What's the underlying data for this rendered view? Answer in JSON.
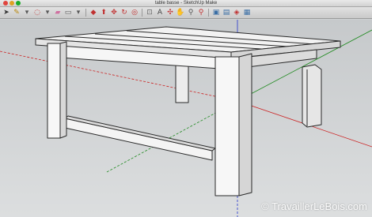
{
  "window": {
    "title": "table basse - SketchUp Make"
  },
  "toolbar": {
    "tools": [
      {
        "name": "select-tool",
        "glyph": "➤",
        "color": "#333333"
      },
      {
        "name": "pencil-tool",
        "glyph": "✎",
        "color": "#b8860b"
      },
      {
        "name": "dropdown-arrow",
        "glyph": "▾",
        "color": "#555555"
      },
      {
        "name": "lasso-tool",
        "glyph": "◌",
        "color": "#c03030"
      },
      {
        "name": "dropdown-arrow",
        "glyph": "▾",
        "color": "#555555"
      },
      {
        "name": "eraser-tool",
        "glyph": "▰",
        "color": "#d070a0"
      },
      {
        "name": "rectangle-tool",
        "glyph": "▭",
        "color": "#555555"
      },
      {
        "name": "dropdown-arrow",
        "glyph": "▾",
        "color": "#555555"
      },
      {
        "name": "paint-bucket-tool",
        "glyph": "◆",
        "color": "#c03030"
      },
      {
        "name": "push-pull-tool",
        "glyph": "⬆",
        "color": "#c03030"
      },
      {
        "name": "move-tool",
        "glyph": "✥",
        "color": "#c03030"
      },
      {
        "name": "rotate-tool",
        "glyph": "↻",
        "color": "#c03030"
      },
      {
        "name": "offset-tool",
        "glyph": "◎",
        "color": "#c03030"
      },
      {
        "name": "tape-measure-tool",
        "glyph": "⊡",
        "color": "#666666"
      },
      {
        "name": "text-tool",
        "glyph": "A",
        "color": "#444444"
      },
      {
        "name": "orbit-tool",
        "glyph": "✣",
        "color": "#c03030"
      },
      {
        "name": "pan-tool",
        "glyph": "✋",
        "color": "#555555"
      },
      {
        "name": "zoom-tool",
        "glyph": "⚲",
        "color": "#555555"
      },
      {
        "name": "zoom-extents-tool",
        "glyph": "⚲",
        "color": "#c03030"
      },
      {
        "name": "warehouse-tool",
        "glyph": "▣",
        "color": "#3a6ea5"
      },
      {
        "name": "components-tool",
        "glyph": "▤",
        "color": "#3a6ea5"
      },
      {
        "name": "extensions-tool",
        "glyph": "◈",
        "color": "#c03030"
      },
      {
        "name": "layout-tool",
        "glyph": "▦",
        "color": "#3a6ea5"
      }
    ]
  },
  "watermark": {
    "text": "TravaillerLeBois.com"
  },
  "colors": {
    "face_light": "#f4f4f4",
    "face_shade": "#d9d9d9",
    "edge": "#2a2a2a",
    "axis_red": "#cc2222",
    "axis_green": "#1f8a1f",
    "axis_blue": "#2233cc"
  }
}
